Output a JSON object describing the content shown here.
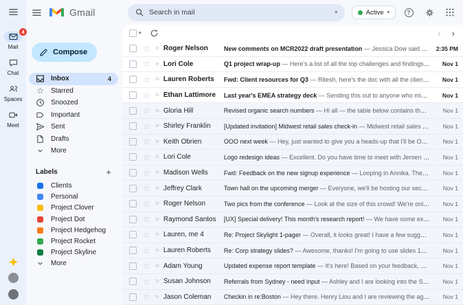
{
  "theme": {
    "compose_accent": "#c2e7ff",
    "selected_pill": "#d3e3fd",
    "badge_red": "#e94235",
    "status_green": "#34a853"
  },
  "rail": {
    "items": [
      {
        "label": "Mail",
        "badge": "4"
      },
      {
        "label": "Chat"
      },
      {
        "label": "Spaces"
      },
      {
        "label": "Meet"
      }
    ]
  },
  "logo": {
    "text": "Gmail"
  },
  "sidebar": {
    "compose_label": "Compose",
    "folders": [
      {
        "label": "Inbox",
        "count": "4"
      },
      {
        "label": "Starred"
      },
      {
        "label": "Snoozed"
      },
      {
        "label": "Important"
      },
      {
        "label": "Sent"
      },
      {
        "label": "Drafts"
      },
      {
        "label": "More"
      }
    ],
    "labels_title": "Labels",
    "labels": [
      {
        "label": "Clients",
        "color": "#1a73e8"
      },
      {
        "label": "Personal",
        "color": "#4285f4"
      },
      {
        "label": "Project Clover",
        "color": "#fbbc04"
      },
      {
        "label": "Project Dot",
        "color": "#ea4335"
      },
      {
        "label": "Project Hedgehog",
        "color": "#fa7b17"
      },
      {
        "label": "Project Rocket",
        "color": "#34a853"
      },
      {
        "label": "Project Skyline",
        "color": "#0b8043"
      },
      {
        "label": "More",
        "color": null
      }
    ]
  },
  "topbar": {
    "search_placeholder": "Search in mail",
    "status_label": "Active"
  },
  "list": {
    "separator": "—",
    "emails": [
      {
        "sender": "Roger Nelson",
        "subject": "New comments on MCR2022 draft presentation",
        "snippet": "Jessica Dow said What ab",
        "date": "2:35 PM",
        "unread": true
      },
      {
        "sender": "Lori Cole",
        "subject": "Q1 project wrap-up",
        "snippet": "Here's a list of all the top challenges and findings. Surpri",
        "date": "Nov 1",
        "unread": true
      },
      {
        "sender": "Lauren Roberts",
        "subject": "Fwd: Client resources for Q3",
        "snippet": "Ritesh, here's the doc with all the client resour",
        "date": "Nov 1",
        "unread": true
      },
      {
        "sender": "Ethan Lattimore",
        "subject": "Last year's EMEA strategy deck",
        "snippet": "Sending this out to anyone who missed it R",
        "date": "Nov 1",
        "unread": true
      },
      {
        "sender": "Gloria Hill",
        "subject": "Revised organic search numbers",
        "snippet": "Hi all — the table below contains the revised",
        "date": "Nov 1",
        "unread": false
      },
      {
        "sender": "Shirley Franklin",
        "subject": "[Updated invitation] Midwest retail sales check-in",
        "snippet": "Midwest retail sales check-",
        "date": "Nov 1",
        "unread": false
      },
      {
        "sender": "Keith Obrien",
        "subject": "OOO next week",
        "snippet": "Hey, just wanted to give you a heads-up that I'll be OOO next",
        "date": "Nov 1",
        "unread": false
      },
      {
        "sender": "Lori Cole",
        "subject": "Logo redesign ideas",
        "snippet": "Excellent. Do you have time to meet with Jeroen and I thi",
        "date": "Nov 1",
        "unread": false
      },
      {
        "sender": "Madison Wells",
        "subject": "Fwd: Feedback on the new signup experience",
        "snippet": "Looping in Annika. The feedbac",
        "date": "Nov 1",
        "unread": false
      },
      {
        "sender": "Jeffrey Clark",
        "subject": "Town hall on the upcoming merger",
        "snippet": "Everyone, we'll be hosting our second tow",
        "date": "Nov 1",
        "unread": false
      },
      {
        "sender": "Roger Nelson",
        "subject": "Two pics from the conference",
        "snippet": "Look at the size of this crowd! We're only halfw",
        "date": "Nov 1",
        "unread": false
      },
      {
        "sender": "Raymond Santos",
        "subject": "[UX] Special delivery! This month's research report!",
        "snippet": "We have some exciting st",
        "date": "Nov 1",
        "unread": false
      },
      {
        "sender": "Lauren, me 4",
        "subject": "Re: Project Skylight 1-pager",
        "snippet": "Overall, it looks great! I have a few suggestions fo",
        "date": "Nov 1",
        "unread": false
      },
      {
        "sender": "Lauren Roberts",
        "subject": "Re: Corp strategy slides?",
        "snippet": "Awesome, thanks! I'm going to use slides 12-27 in m",
        "date": "Nov 1",
        "unread": false
      },
      {
        "sender": "Adam Young",
        "subject": "Updated expense report template",
        "snippet": "It's here! Based on your feedback, we've (",
        "date": "Nov 1",
        "unread": false
      },
      {
        "sender": "Susan Johnson",
        "subject": "Referrals from Sydney - need input",
        "snippet": "Ashley and I are looking into the Sydney m",
        "date": "Nov 1",
        "unread": false
      },
      {
        "sender": "Jason Coleman",
        "subject": "Checkin in re:Boston",
        "snippet": "Hey there. Henry Liou and I are reviewing the agenda fo",
        "date": "Nov 1",
        "unread": false
      }
    ]
  }
}
